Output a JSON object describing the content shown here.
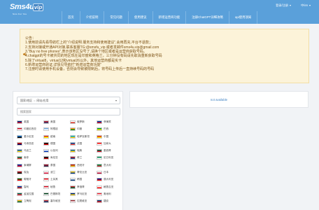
{
  "brand": {
    "logo_text": "Sms4u",
    "logo_badge": "vip",
    "tagline": "Sms For You"
  },
  "nav": [
    "首页",
    "介绍说明",
    "常见问题",
    "使用建议",
    "新增运营商功能",
    "注册ChatGPT详细攻略",
    "api使用须知"
  ],
  "top_right": {
    "account": "登录/注册",
    "language": "中/en"
  },
  "notice": {
    "lines": [
      "公告：",
      "1.使用前请先看导航栏上的\"介绍说明 服务支持和使用建议\",会用再充,平台不退款；",
      "2.支持对接或开通API对接,联系客服TG:@smsfu_vip 或者发邮件sms4u.vip@gmail.com",
      "3.\"Buy no free phones\",表示该地区没号了,请换个地区或者是运营商获取号码。",
      "4.chatgpt的号卡被共同的地区现在是印度和英格兰，三分钟没有码请先取消重新获取号码",
      "5.除了virtual8，virtual12和virtual26以外，其他运营商都是实卡",
      "6.新增运营商验证,详情见导航栏\"新增运营商功能\"",
      "7.注册时请使用手机设备，否则会导致被限制后，将号码上传后一直持续号码的号码"
    ]
  },
  "filters": {
    "region_select": "国家/地区 ⇔ 网站/应用",
    "search_placeholder": "搜索国家"
  },
  "countries": [
    {
      "name": "英国",
      "colors": [
        "#00247d",
        "#cf142b"
      ]
    },
    {
      "name": "美国",
      "colors": [
        "#b22234",
        "#3c3b6e"
      ]
    },
    {
      "name": "俄罗斯",
      "colors": [
        "#ffffff",
        "#d52b1e"
      ]
    },
    {
      "name": "菲律宾",
      "colors": [
        "#0038a8",
        "#ce1126"
      ]
    },
    {
      "name": "印度尼西亚",
      "colors": [
        "#ce1126",
        "#ffffff"
      ]
    },
    {
      "name": "阿根廷",
      "colors": [
        "#74acdf",
        "#ffffff"
      ]
    },
    {
      "name": "印度",
      "colors": [
        "#ff9933",
        "#138808"
      ]
    },
    {
      "name": "巴西",
      "colors": [
        "#009c3b",
        "#ffdf00"
      ]
    },
    {
      "name": "爱沙尼亚",
      "colors": [
        "#0072ce",
        "#000000"
      ]
    },
    {
      "name": "越南",
      "colors": [
        "#da251d",
        "#ffff00"
      ]
    },
    {
      "name": "哈萨克斯坦",
      "colors": [
        "#00afca",
        "#fec50c"
      ]
    },
    {
      "name": "中国",
      "colors": [
        "#de2910",
        "#ffde00"
      ]
    },
    {
      "name": "马来西亚",
      "colors": [
        "#cc0001",
        "#010066"
      ]
    },
    {
      "name": "德国",
      "colors": [
        "#000000",
        "#dd0000"
      ]
    },
    {
      "name": "法国",
      "colors": [
        "#0055a4",
        "#ef4135"
      ]
    },
    {
      "name": "加拿大",
      "colors": [
        "#ff0000",
        "#ffffff"
      ]
    },
    {
      "name": "乌克兰",
      "colors": [
        "#0057b7",
        "#ffd700"
      ]
    },
    {
      "name": "以色列",
      "colors": [
        "#ffffff",
        "#0038b8"
      ]
    },
    {
      "name": "瑞典",
      "colors": [
        "#006aa7",
        "#fecc00"
      ]
    },
    {
      "name": "墨西哥",
      "colors": [
        "#006847",
        "#ce1126"
      ]
    },
    {
      "name": "南非",
      "colors": [
        "#007749",
        "#de3831"
      ]
    },
    {
      "name": "肯尼亚",
      "colors": [
        "#000000",
        "#bb0000"
      ]
    },
    {
      "name": "荷兰",
      "colors": [
        "#ae1c28",
        "#21468b"
      ]
    },
    {
      "name": "尼日利亚",
      "colors": [
        "#008751",
        "#ffffff"
      ]
    },
    {
      "name": "柬埔寨",
      "colors": [
        "#032ea1",
        "#e00025"
      ]
    },
    {
      "name": "泰国",
      "colors": [
        "#a51931",
        "#2d2a4a"
      ]
    },
    {
      "name": "西班牙",
      "colors": [
        "#aa151b",
        "#f1bf00"
      ]
    },
    {
      "name": "意大利",
      "colors": [
        "#009246",
        "#ce2b37"
      ]
    },
    {
      "name": "埃及",
      "colors": [
        "#ce1126",
        "#000000"
      ]
    },
    {
      "name": "波兰",
      "colors": [
        "#ffffff",
        "#dc143c"
      ]
    },
    {
      "name": "哥伦比亚",
      "colors": [
        "#fcd116",
        "#003893"
      ]
    },
    {
      "name": "日本",
      "colors": [
        "#ffffff",
        "#bc002d"
      ]
    },
    {
      "name": "葡萄牙",
      "colors": [
        "#006600",
        "#ff0000"
      ]
    },
    {
      "name": "土耳其",
      "colors": [
        "#e30a17",
        "#ffffff"
      ]
    },
    {
      "name": "韩国",
      "colors": [
        "#ffffff",
        "#003478"
      ]
    },
    {
      "name": "澳大利亚",
      "colors": [
        "#00008b",
        "#ff0000"
      ]
    },
    {
      "name": "智利",
      "colors": [
        "#0039a6",
        "#d52b1e"
      ]
    },
    {
      "name": "秘鲁",
      "colors": [
        "#d91023",
        "#ffffff"
      ]
    },
    {
      "name": "摩洛哥",
      "colors": [
        "#c1272d",
        "#006233"
      ]
    },
    {
      "name": "格鲁吉亚",
      "colors": [
        "#ffffff",
        "#ff0000"
      ]
    },
    {
      "name": "孟加拉国",
      "colors": [
        "#006a4e",
        "#f42a41"
      ]
    },
    {
      "name": "巴基斯坦",
      "colors": [
        "#01411c",
        "#ffffff"
      ]
    },
    {
      "name": "罗马尼亚",
      "colors": [
        "#002b7f",
        "#fcd116"
      ]
    },
    {
      "name": "奥地利",
      "colors": [
        "#ed2939",
        "#ffffff"
      ]
    },
    {
      "name": "立陶宛",
      "colors": [
        "#fdb913",
        "#006a44"
      ]
    },
    {
      "name": "塞尔维亚",
      "colors": [
        "#c6363c",
        "#0c4076"
      ]
    },
    {
      "name": "拉脱维亚",
      "colors": [
        "#9e3039",
        "#ffffff"
      ]
    },
    {
      "name": "捷克",
      "colors": [
        "#11457e",
        "#d7141a"
      ]
    }
  ],
  "content": {
    "not_available": "not available"
  }
}
